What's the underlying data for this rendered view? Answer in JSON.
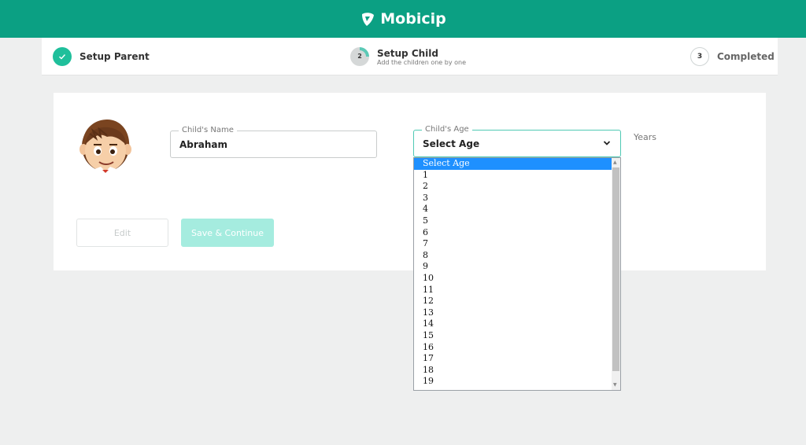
{
  "header": {
    "brand": "Mobicip"
  },
  "stepper": {
    "step1": {
      "label": "Setup Parent"
    },
    "step2": {
      "number": "2",
      "label": "Setup Child",
      "sub": "Add the children one by one",
      "progress_fraction": 0.25
    },
    "step3": {
      "number": "3",
      "label": "Completed"
    }
  },
  "form": {
    "name": {
      "legend": "Child's Name",
      "value": "Abraham"
    },
    "age": {
      "legend": "Child's Age",
      "value": "Select Age",
      "unit": "Years"
    },
    "edit_label": "Edit",
    "save_label": "Save & Continue"
  },
  "age_options": [
    "Select Age",
    "1",
    "2",
    "3",
    "4",
    "5",
    "6",
    "7",
    "8",
    "9",
    "10",
    "11",
    "12",
    "13",
    "14",
    "15",
    "16",
    "17",
    "18",
    "19"
  ],
  "colors": {
    "brand": "#0ba083",
    "accent": "#1fbf9b",
    "selected_option": "#1e90ff"
  }
}
